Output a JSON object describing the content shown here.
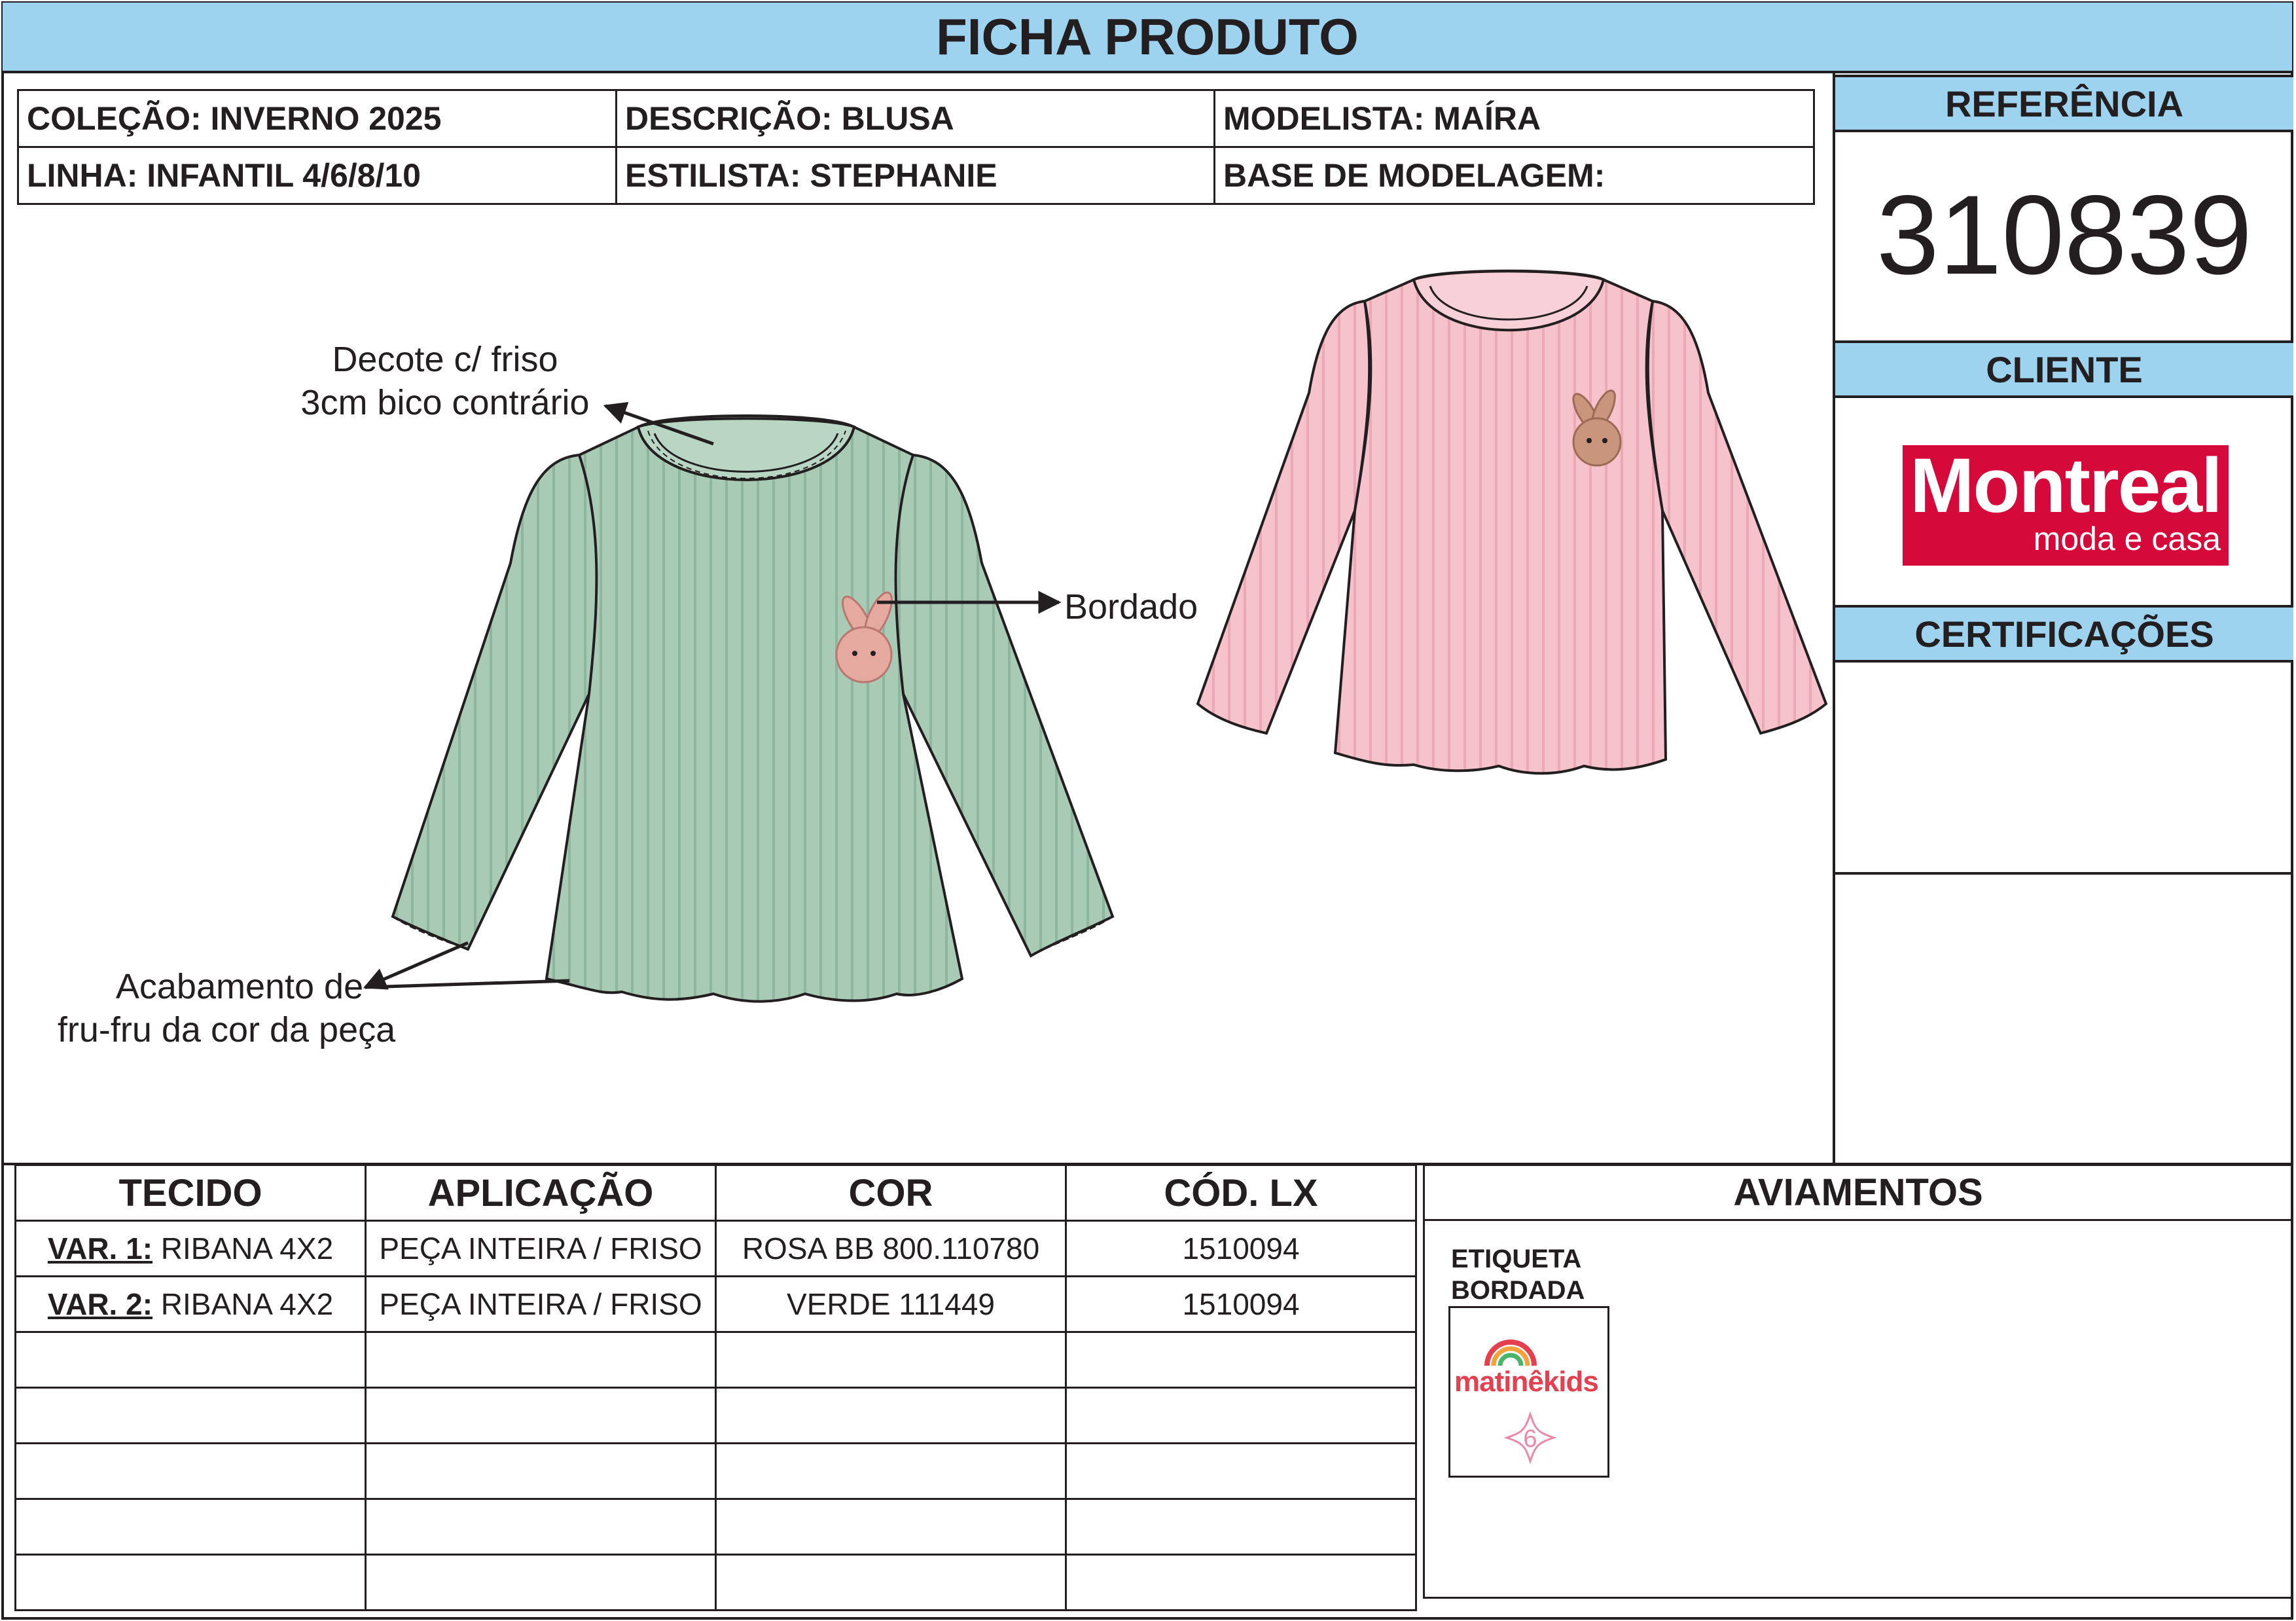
{
  "header": {
    "title": "FICHA PRODUTO"
  },
  "info": {
    "colecao": "COLEÇÃO: INVERNO 2025",
    "descricao": "DESCRIÇÃO: BLUSA",
    "modelista": "MODELISTA: MAÍRA",
    "linha": "LINHA: INFANTIL 4/6/8/10",
    "estilista": "ESTILISTA: STEPHANIE",
    "base": "BASE DE MODELAGEM:"
  },
  "sidebar": {
    "referencia_label": "REFERÊNCIA",
    "referencia_value": "310839",
    "cliente_label": "CLIENTE",
    "cliente_logo": {
      "name": "Montreal",
      "tagline": "moda e casa",
      "color": "#d60a3a"
    },
    "certificacoes_label": "CERTIFICAÇÕES"
  },
  "annotations": {
    "decote_l1": "Decote c/ friso",
    "decote_l2": "3cm bico contrário",
    "bordado": "Bordado",
    "acab_l1": "Acabamento de",
    "acab_l2": "fru-fru da cor da peça"
  },
  "garments": {
    "green": "#a9cbb6",
    "pink": "#f6c3cc",
    "outline": "#231f20",
    "embroidery": "#e6a9a0"
  },
  "fabric_table": {
    "headers": [
      "TECIDO",
      "APLICAÇÃO",
      "COR",
      "CÓD. LX"
    ],
    "rows": [
      {
        "var": "VAR. 1:",
        "tecido": "RIBANA 4X2",
        "aplicacao": "PEÇA INTEIRA / FRISO",
        "cor": "ROSA BB 800.110780",
        "cod": "1510094"
      },
      {
        "var": "VAR. 2:",
        "tecido": "RIBANA 4X2",
        "aplicacao": "PEÇA INTEIRA / FRISO",
        "cor": "VERDE 111449",
        "cod": "1510094"
      }
    ]
  },
  "aviamentos": {
    "title": "AVIAMENTOS",
    "etiqueta_l1": "ETIQUETA",
    "etiqueta_l2": "BORDADA",
    "label_brand": "matinêkids",
    "label_size": "6"
  },
  "colors": {
    "header_blue": "#9dd3ef",
    "line": "#231f20"
  }
}
